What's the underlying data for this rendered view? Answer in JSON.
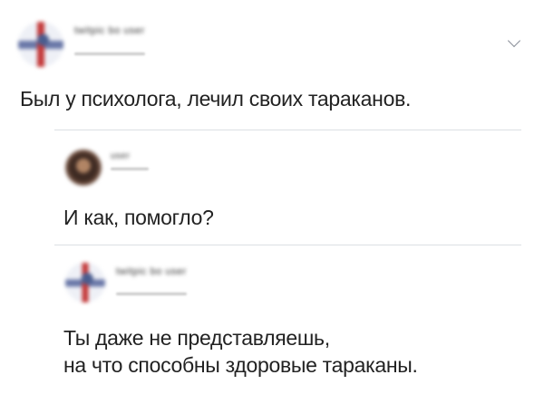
{
  "tweets": [
    {
      "author_name": "twitpic bo user",
      "handle": "",
      "avatar_icon": "avatar-cross",
      "text": "Был у психолога, лечил своих тараканов.",
      "menu_icon": "chevron-down-icon"
    },
    {
      "author_name": "user",
      "handle": "",
      "avatar_icon": "avatar-photo",
      "text": "И как, помогло?"
    },
    {
      "author_name": "twitpic bo user",
      "handle": "",
      "avatar_icon": "avatar-cross",
      "text": "Ты даже не представляешь,\nна что способны здоровые тараканы."
    }
  ]
}
